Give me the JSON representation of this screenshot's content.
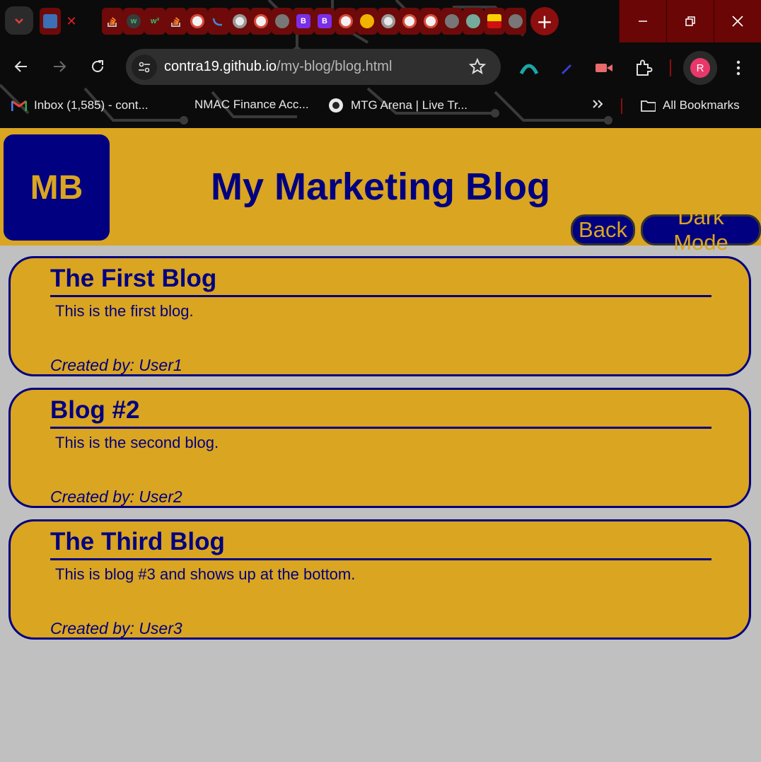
{
  "browser": {
    "url_host": "contra19.github.io",
    "url_path": "/my-blog/blog.html",
    "profile_initial": "R",
    "tab_close_glyph": "✕",
    "new_tab_glyph": "+",
    "tab_badges": [
      "B",
      "B"
    ],
    "bookmarks": [
      {
        "label": "Inbox (1,585) - cont...",
        "icon": "gmail-icon"
      },
      {
        "label": "NMAC Finance Acc...",
        "icon": "none"
      },
      {
        "label": "MTG Arena | Live Tr...",
        "icon": "mtg-icon"
      }
    ],
    "all_bookmarks_label": "All Bookmarks",
    "accent_color": "#8c0e0e"
  },
  "header": {
    "logo_text": "MB",
    "title": "My Marketing Blog",
    "back_label": "Back",
    "dark_mode_label": "Dark Mode"
  },
  "posts": [
    {
      "title": "The First Blog",
      "body": "This is the first blog.",
      "author": "Created by: User1"
    },
    {
      "title": "Blog #2",
      "body": "This is the second blog.",
      "author": "Created by: User2"
    },
    {
      "title": "The Third Blog",
      "body": "This is blog #3 and shows up at the bottom.",
      "author": "Created by: User3"
    }
  ],
  "colors": {
    "primary_navy": "#000080",
    "gold": "#daa520",
    "background_gray": "#c0c0c0"
  }
}
